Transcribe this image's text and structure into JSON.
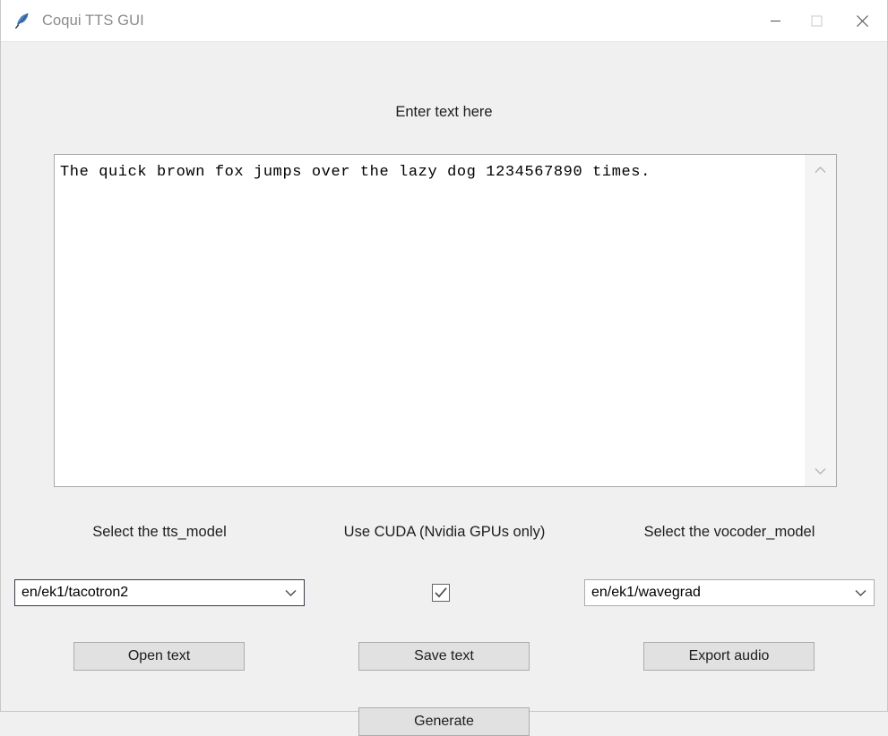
{
  "window": {
    "title": "Coqui TTS GUI",
    "icon": "feather-icon",
    "controls": {
      "minimize": "minimize-icon",
      "maximize": "maximize-icon",
      "close": "close-icon"
    }
  },
  "main": {
    "text_area_label": "Enter text here",
    "text_area_value": "The quick brown fox jumps over the lazy dog 1234567890 times.",
    "text_area_placeholder": "",
    "scrollbar": {
      "up": "chevron-up-icon",
      "down": "chevron-down-icon"
    },
    "columns": {
      "tts_model_label": "Select the tts_model",
      "use_cuda_label": "Use CUDA (Nvidia GPUs only)",
      "vocoder_model_label": "Select the vocoder_model"
    },
    "tts_model": {
      "selected": "en/ek1/tacotron2",
      "arrow": "chevron-down-icon"
    },
    "vocoder_model": {
      "selected": "en/ek1/wavegrad",
      "arrow": "chevron-down-icon"
    },
    "use_cuda": {
      "checked": true,
      "glyph": "checkmark-icon"
    },
    "buttons": {
      "open_text": "Open text",
      "save_text": "Save text",
      "export_audio": "Export audio",
      "generate": "Generate"
    }
  },
  "colors": {
    "window_background": "#f0f0f0",
    "title_bar_background": "#ffffff",
    "title_text": "#8a8a8a",
    "button_face": "#e1e1e1",
    "button_border": "#adadad",
    "focused_border": "#3c3c48",
    "text": "#1d1d1d",
    "accent": "#4a7ebb"
  }
}
